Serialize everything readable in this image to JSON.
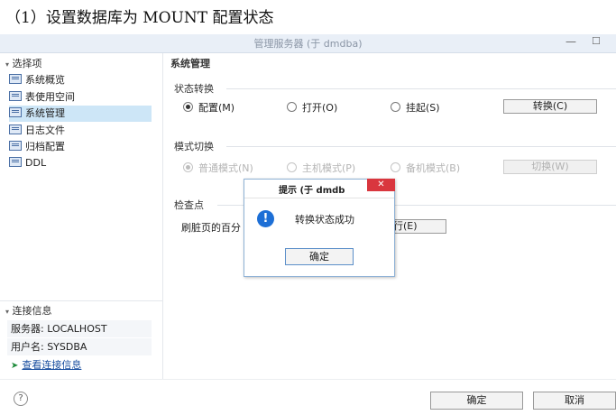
{
  "caption": "（1）设置数据库为 MOUNT 配置状态",
  "window": {
    "title": "管理服务器 (于 dmdba)",
    "minimize": "—",
    "maximize": "☐"
  },
  "sidebar": {
    "tree_header": "选择项",
    "items": [
      {
        "label": "系统概览"
      },
      {
        "label": "表使用空间"
      },
      {
        "label": "系统管理"
      },
      {
        "label": "日志文件"
      },
      {
        "label": "归档配置"
      },
      {
        "label": "DDL"
      }
    ],
    "connection": {
      "header": "连接信息",
      "server": "服务器: LOCALHOST",
      "user": "用户名: SYSDBA",
      "link": "查看连接信息"
    }
  },
  "main": {
    "heading": "系统管理",
    "state": {
      "title": "状态转换",
      "options": [
        "配置(M)",
        "打开(O)",
        "挂起(S)"
      ],
      "selected": "配置(M)",
      "button": "转换(C)"
    },
    "mode": {
      "title": "模式切换",
      "options": [
        "普通模式(N)",
        "主机模式(P)",
        "备机模式(B)"
      ],
      "selected": "普通模式(N)",
      "button": "切换(W)"
    },
    "checkpoint": {
      "title": "检查点",
      "label": "刷脏页的百分",
      "button": "行(E)"
    }
  },
  "dialog": {
    "title": "提示  (于 dmdb",
    "close": "✕",
    "message": "转换状态成功",
    "ok": "确定",
    "icon": "info-icon"
  },
  "footer": {
    "help": "?",
    "ok": "确定",
    "cancel": "取消"
  },
  "colors": {
    "selection": "#cde6f7",
    "accent": "#1d6fd6",
    "close_button": "#d9363e"
  }
}
